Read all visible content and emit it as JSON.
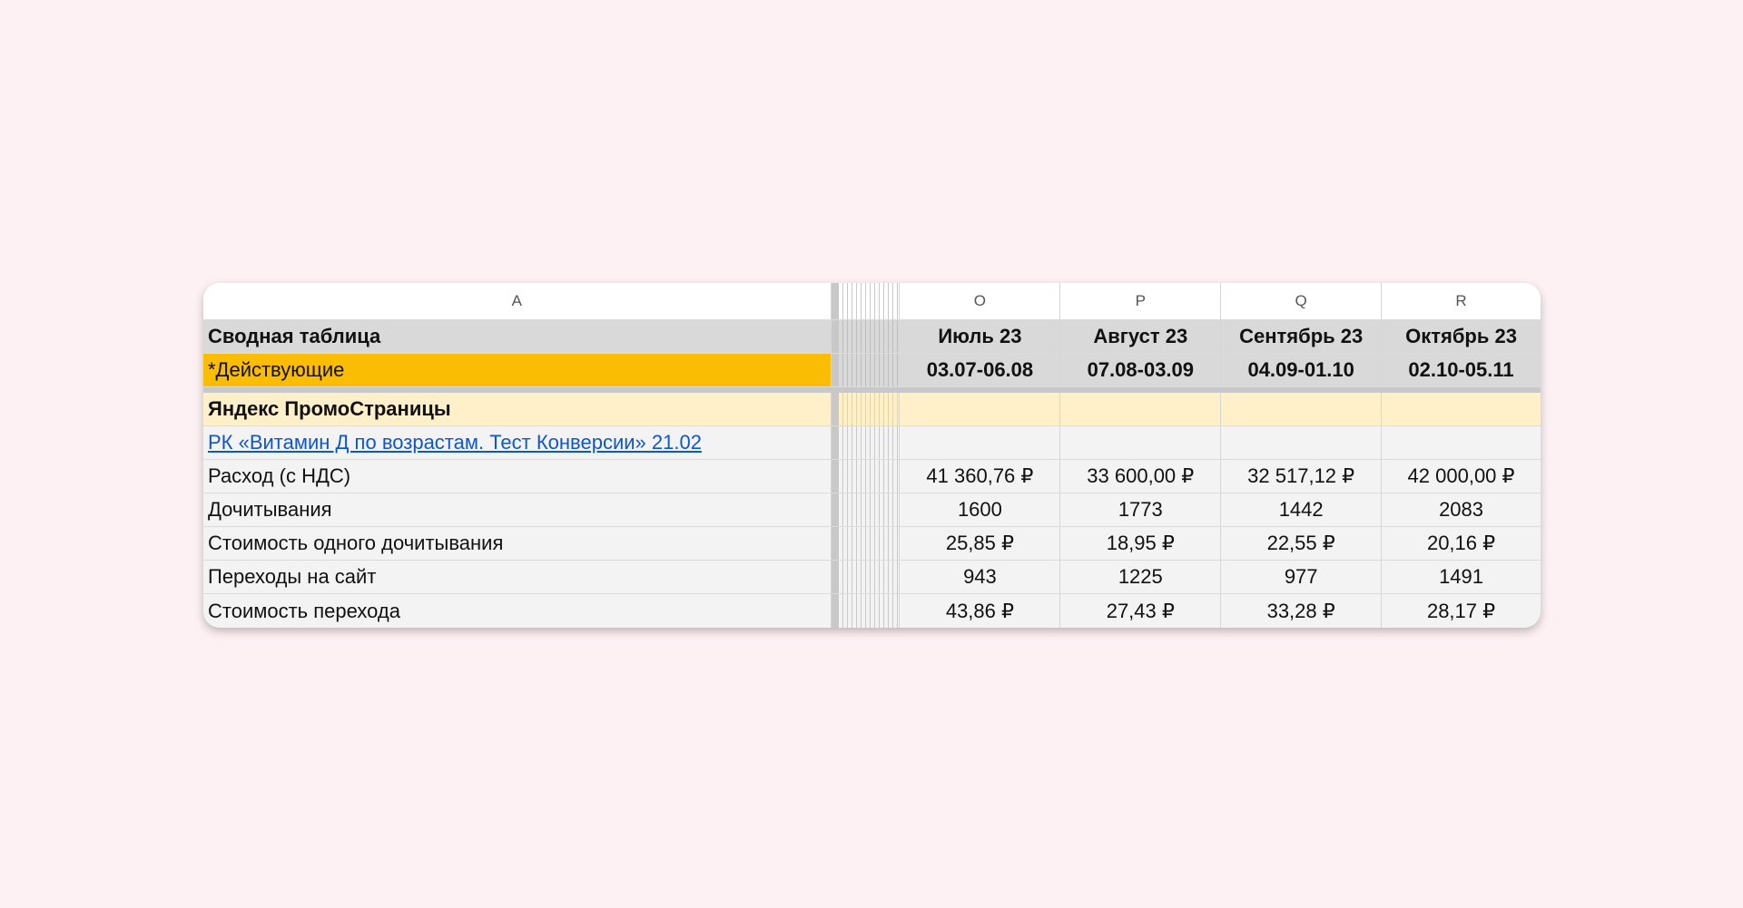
{
  "columns": {
    "a": "A",
    "o": "O",
    "p": "P",
    "q": "Q",
    "r": "R"
  },
  "title_row": {
    "label": "Сводная таблица",
    "months": [
      "Июль 23",
      "Август 23",
      "Сентябрь 23",
      "Октябрь 23"
    ]
  },
  "period_row": {
    "label": "*Действующие",
    "periods": [
      "03.07-06.08",
      "07.08-03.09",
      "04.09-01.10",
      "02.10-05.11"
    ]
  },
  "section": {
    "label": "Яндекс ПромоСтраницы"
  },
  "campaign": {
    "label": "РК «Витамин Д по возрастам. Тест Конверсии» 21.02"
  },
  "metrics": [
    {
      "label": "Расход (с НДС)",
      "values": [
        "41 360,76 ₽",
        "33 600,00 ₽",
        "32 517,12 ₽",
        "42 000,00 ₽"
      ]
    },
    {
      "label": "Дочитывания",
      "values": [
        "1600",
        "1773",
        "1442",
        "2083"
      ]
    },
    {
      "label": "Стоимость одного дочитывания",
      "values": [
        "25,85 ₽",
        "18,95 ₽",
        "22,55 ₽",
        "20,16 ₽"
      ]
    },
    {
      "label": "Переходы на сайт",
      "values": [
        "943",
        "1225",
        "977",
        "1491"
      ]
    },
    {
      "label": "Стоимость перехода",
      "values": [
        "43,86 ₽",
        "27,43 ₽",
        "33,28 ₽",
        "28,17 ₽"
      ]
    }
  ],
  "colors": {
    "orange": "#fbbc04",
    "section": "#fff0c9",
    "link": "#1155cc",
    "background": "#fdf1f4"
  }
}
